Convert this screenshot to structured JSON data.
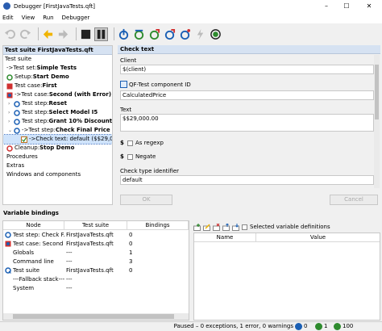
{
  "window": {
    "title": "Debugger [FirstJavaTests.qft]"
  },
  "menu": [
    "Edit",
    "View",
    "Run",
    "Debugger"
  ],
  "tree": {
    "header": "Test suite FirstJavaTests.qft",
    "rows": [
      {
        "prefix": "Test suite",
        "bold": ""
      },
      {
        "prefix": "->Test set: ",
        "bold": "Simple Tests"
      },
      {
        "prefix": "Setup: ",
        "bold": "Start Demo"
      },
      {
        "prefix": "Test case: ",
        "bold": "First"
      },
      {
        "prefix": "->Test case: ",
        "bold": "Second (with Error)"
      },
      {
        "prefix": "Test step: ",
        "bold": "Reset"
      },
      {
        "prefix": "Test step: ",
        "bold": "Select Model I5"
      },
      {
        "prefix": "Test step: ",
        "bold": "Grant 10% Discount"
      },
      {
        "prefix": "->Test step: ",
        "bold": "Check Final Price (car"
      },
      {
        "prefix": "->Check text: default ($$29,000.",
        "bold": ""
      },
      {
        "prefix": "Cleanup: ",
        "bold": "Stop Demo"
      },
      {
        "prefix": "Procedures",
        "bold": ""
      },
      {
        "prefix": "Extras",
        "bold": ""
      },
      {
        "prefix": "Windows and components",
        "bold": ""
      }
    ]
  },
  "detail": {
    "header": "Check text",
    "client_label": "Client",
    "client_value": "$(client)",
    "component_label": "QF-Test component ID",
    "component_value": "CalculatedPrice",
    "text_label": "Text",
    "text_value": "$$29,000.00",
    "regexp_label": "As regexp",
    "negate_label": "Negate",
    "dollar": "$",
    "check_type_label": "Check type identifier",
    "check_type_value": "default",
    "ok": "OK",
    "cancel": "Cancel"
  },
  "bindings": {
    "title": "Variable bindings",
    "columns": [
      "Node",
      "Test suite",
      "Bindings"
    ],
    "rows": [
      {
        "node": "Test step: Check F...",
        "suite": "FirstJavaTests.qft",
        "bindings": "0"
      },
      {
        "node": "Test case: Second ...",
        "suite": "FirstJavaTests.qft",
        "bindings": "0"
      },
      {
        "node": "Globals",
        "suite": "---",
        "bindings": "1"
      },
      {
        "node": "Command line",
        "suite": "---",
        "bindings": "3"
      },
      {
        "node": "Test suite",
        "suite": "FirstJavaTests.qft",
        "bindings": "0"
      },
      {
        "node": "---Fallback stack---",
        "suite": "---",
        "bindings": ""
      },
      {
        "node": "System",
        "suite": "---",
        "bindings": ""
      }
    ]
  },
  "definitions": {
    "checkbox_label": "Selected variable definitions",
    "columns": [
      "Name",
      "Value"
    ]
  },
  "status": {
    "text": "Paused – 0 exceptions, 1 error, 0 warnings",
    "count_error": "0",
    "count_pass": "1",
    "count_total": "100"
  }
}
